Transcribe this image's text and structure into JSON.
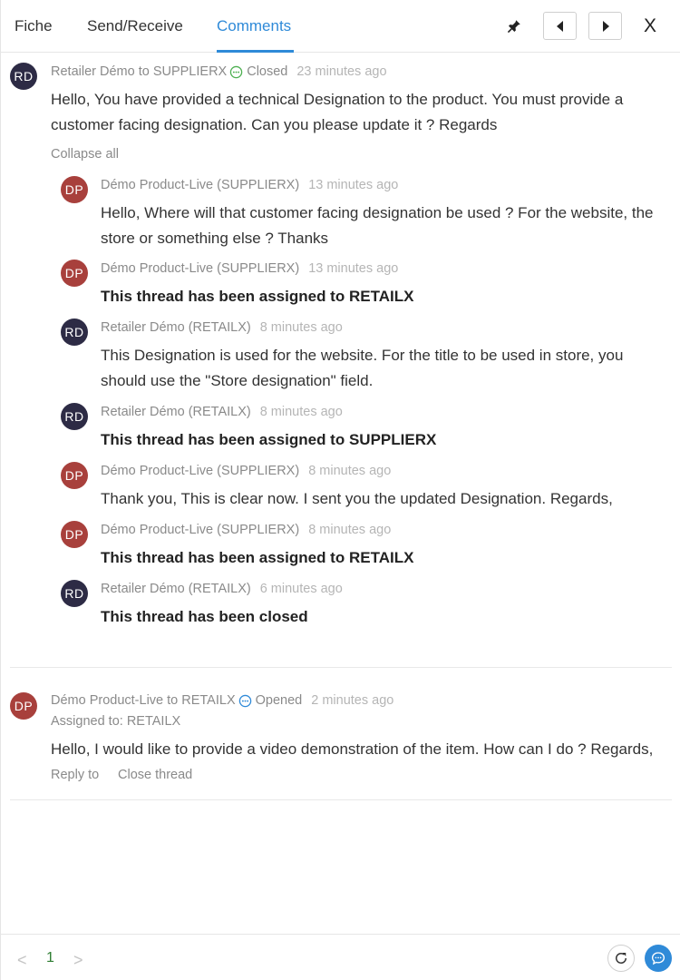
{
  "tabs": [
    {
      "label": "Fiche"
    },
    {
      "label": "Send/Receive"
    },
    {
      "label": "Comments"
    }
  ],
  "icons": {
    "pin": "pin-icon",
    "prev": "caret-left-icon",
    "next": "caret-right-icon",
    "close": "close-icon",
    "refresh": "refresh-icon",
    "chat": "chat-icon"
  },
  "close_label": "X",
  "threads": [
    {
      "avatar": "RD",
      "author": "Retailer Démo to SUPPLIERX",
      "status": "Closed",
      "status_color": "#4caf50",
      "time": "23 minutes ago",
      "message": "Hello, You have provided a technical Designation to the product. You must provide a customer facing designation. Can you please update it ? Regards",
      "collapse_label": "Collapse all",
      "replies": [
        {
          "avatar": "DP",
          "author": "Démo Product-Live (SUPPLIERX)",
          "time": "13 minutes ago",
          "message": "Hello, Where will that customer facing designation be used ? For the website, the store or something else ? Thanks"
        },
        {
          "avatar": "DP",
          "author": "Démo Product-Live (SUPPLIERX)",
          "time": "13 minutes ago",
          "message": "This thread has been assigned to RETAILX"
        },
        {
          "avatar": "RD",
          "author": "Retailer Démo (RETAILX)",
          "time": "8 minutes ago",
          "message": "This Designation is used for the website. For the title to be used in store, you should use the \"Store designation\" field."
        },
        {
          "avatar": "RD",
          "author": "Retailer Démo (RETAILX)",
          "time": "8 minutes ago",
          "message": "This thread has been assigned to SUPPLIERX"
        },
        {
          "avatar": "DP",
          "author": "Démo Product-Live (SUPPLIERX)",
          "time": "8 minutes ago",
          "message": "Thank you, This is clear now. I sent you the updated Designation. Regards,"
        },
        {
          "avatar": "DP",
          "author": "Démo Product-Live (SUPPLIERX)",
          "time": "8 minutes ago",
          "message": "This thread has been assigned to RETAILX"
        },
        {
          "avatar": "RD",
          "author": "Retailer Démo (RETAILX)",
          "time": "6 minutes ago",
          "message": "This thread has been closed"
        }
      ]
    },
    {
      "avatar": "DP",
      "author": "Démo Product-Live to RETAILX",
      "status": "Opened",
      "status_color": "#2f8ad8",
      "time": "2 minutes ago",
      "assigned": "Assigned to: RETAILX",
      "message": "Hello, I would like to provide a video demonstration of the item. How can I do ? Regards,",
      "reply_label": "Reply to",
      "close_thread_label": "Close thread"
    }
  ],
  "pagination": {
    "page": "1",
    "prev": "<",
    "next": ">"
  },
  "colors": {
    "accent": "#2f8ad8",
    "avatar_rd": "#2d2b45",
    "avatar_dp": "#a8403c"
  }
}
